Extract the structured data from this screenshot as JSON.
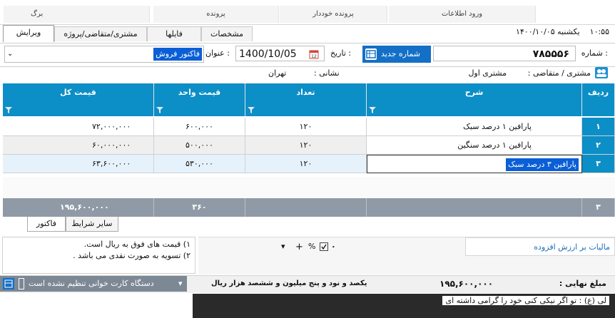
{
  "ribbon": {
    "tabs": [
      "ورود اطلاعات",
      "پرونده خوددار",
      "پرونده",
      "برگ"
    ]
  },
  "tabs2": {
    "items": [
      "ویرایش",
      "مشتری/متقاضی/پروژه",
      "فایلها",
      "مشخصات"
    ],
    "active_index": 0
  },
  "clock": {
    "time": "۱۰:۵۵",
    "day": "یکشنبه",
    "date": "۱۴۰۰/۱۰/۰۵"
  },
  "header": {
    "number_label": "شماره :",
    "number_value": "۷۸۵۵۵۶",
    "new_number_button": "شماره جدید",
    "date_label": "تاریخ :",
    "date_value": "1400/10/05",
    "title_label": "عنوان :",
    "title_value": "فاکتور فروش"
  },
  "customer": {
    "label": "مشتری / متقاضی :",
    "value": "مشتری اول",
    "address_label": "نشانی :",
    "address_value": "تهران"
  },
  "grid": {
    "columns": [
      "ردیف",
      "شرح",
      "تعداد",
      "قیمت واحد",
      "قیمت کل"
    ],
    "rows": [
      {
        "no": "۱",
        "desc": "پارافین ۱ درصد سبک",
        "qty": "۱۲۰",
        "unit": "۶۰۰,۰۰۰",
        "total": "۷۲,۰۰۰,۰۰۰"
      },
      {
        "no": "۲",
        "desc": "پارافین ۱ درصد سنگین",
        "qty": "۱۲۰",
        "unit": "۵۰۰,۰۰۰",
        "total": "۶۰,۰۰۰,۰۰۰"
      },
      {
        "no": "۳",
        "desc": "پارافین ۳ درصد سبک",
        "qty": "۱۲۰",
        "unit": "۵۳۰,۰۰۰",
        "total": "۶۳,۶۰۰,۰۰۰"
      }
    ],
    "totals": {
      "count": "۳",
      "qty": "۳۶۰",
      "total": "۱۹۵,۶۰۰,۰۰۰"
    }
  },
  "bottom_tabs": [
    "فاکتور",
    "سایر شرایط"
  ],
  "notes": {
    "line1": "۱) قیمت های فوق به ریال است.",
    "line2": "۲) تسویه به صورت نقدی می باشد ."
  },
  "vat": {
    "label": "مالیات بر ارزش افزوده",
    "value": "۰",
    "percent": "%",
    "plus": "+",
    "dropdown": "▾"
  },
  "final": {
    "label": "مبلغ نهایی :",
    "value": "۱۹۵,۶۰۰,۰۰۰",
    "words": "یکصد و نود و پنج میلیون و ششصد  هزار  ریال",
    "device": "دستگاه کارت خوانی تنظیم نشده است"
  },
  "clipped_line": "لی (ع) : تو اگر نیکی کنی خود را گرامی داشته ای"
}
